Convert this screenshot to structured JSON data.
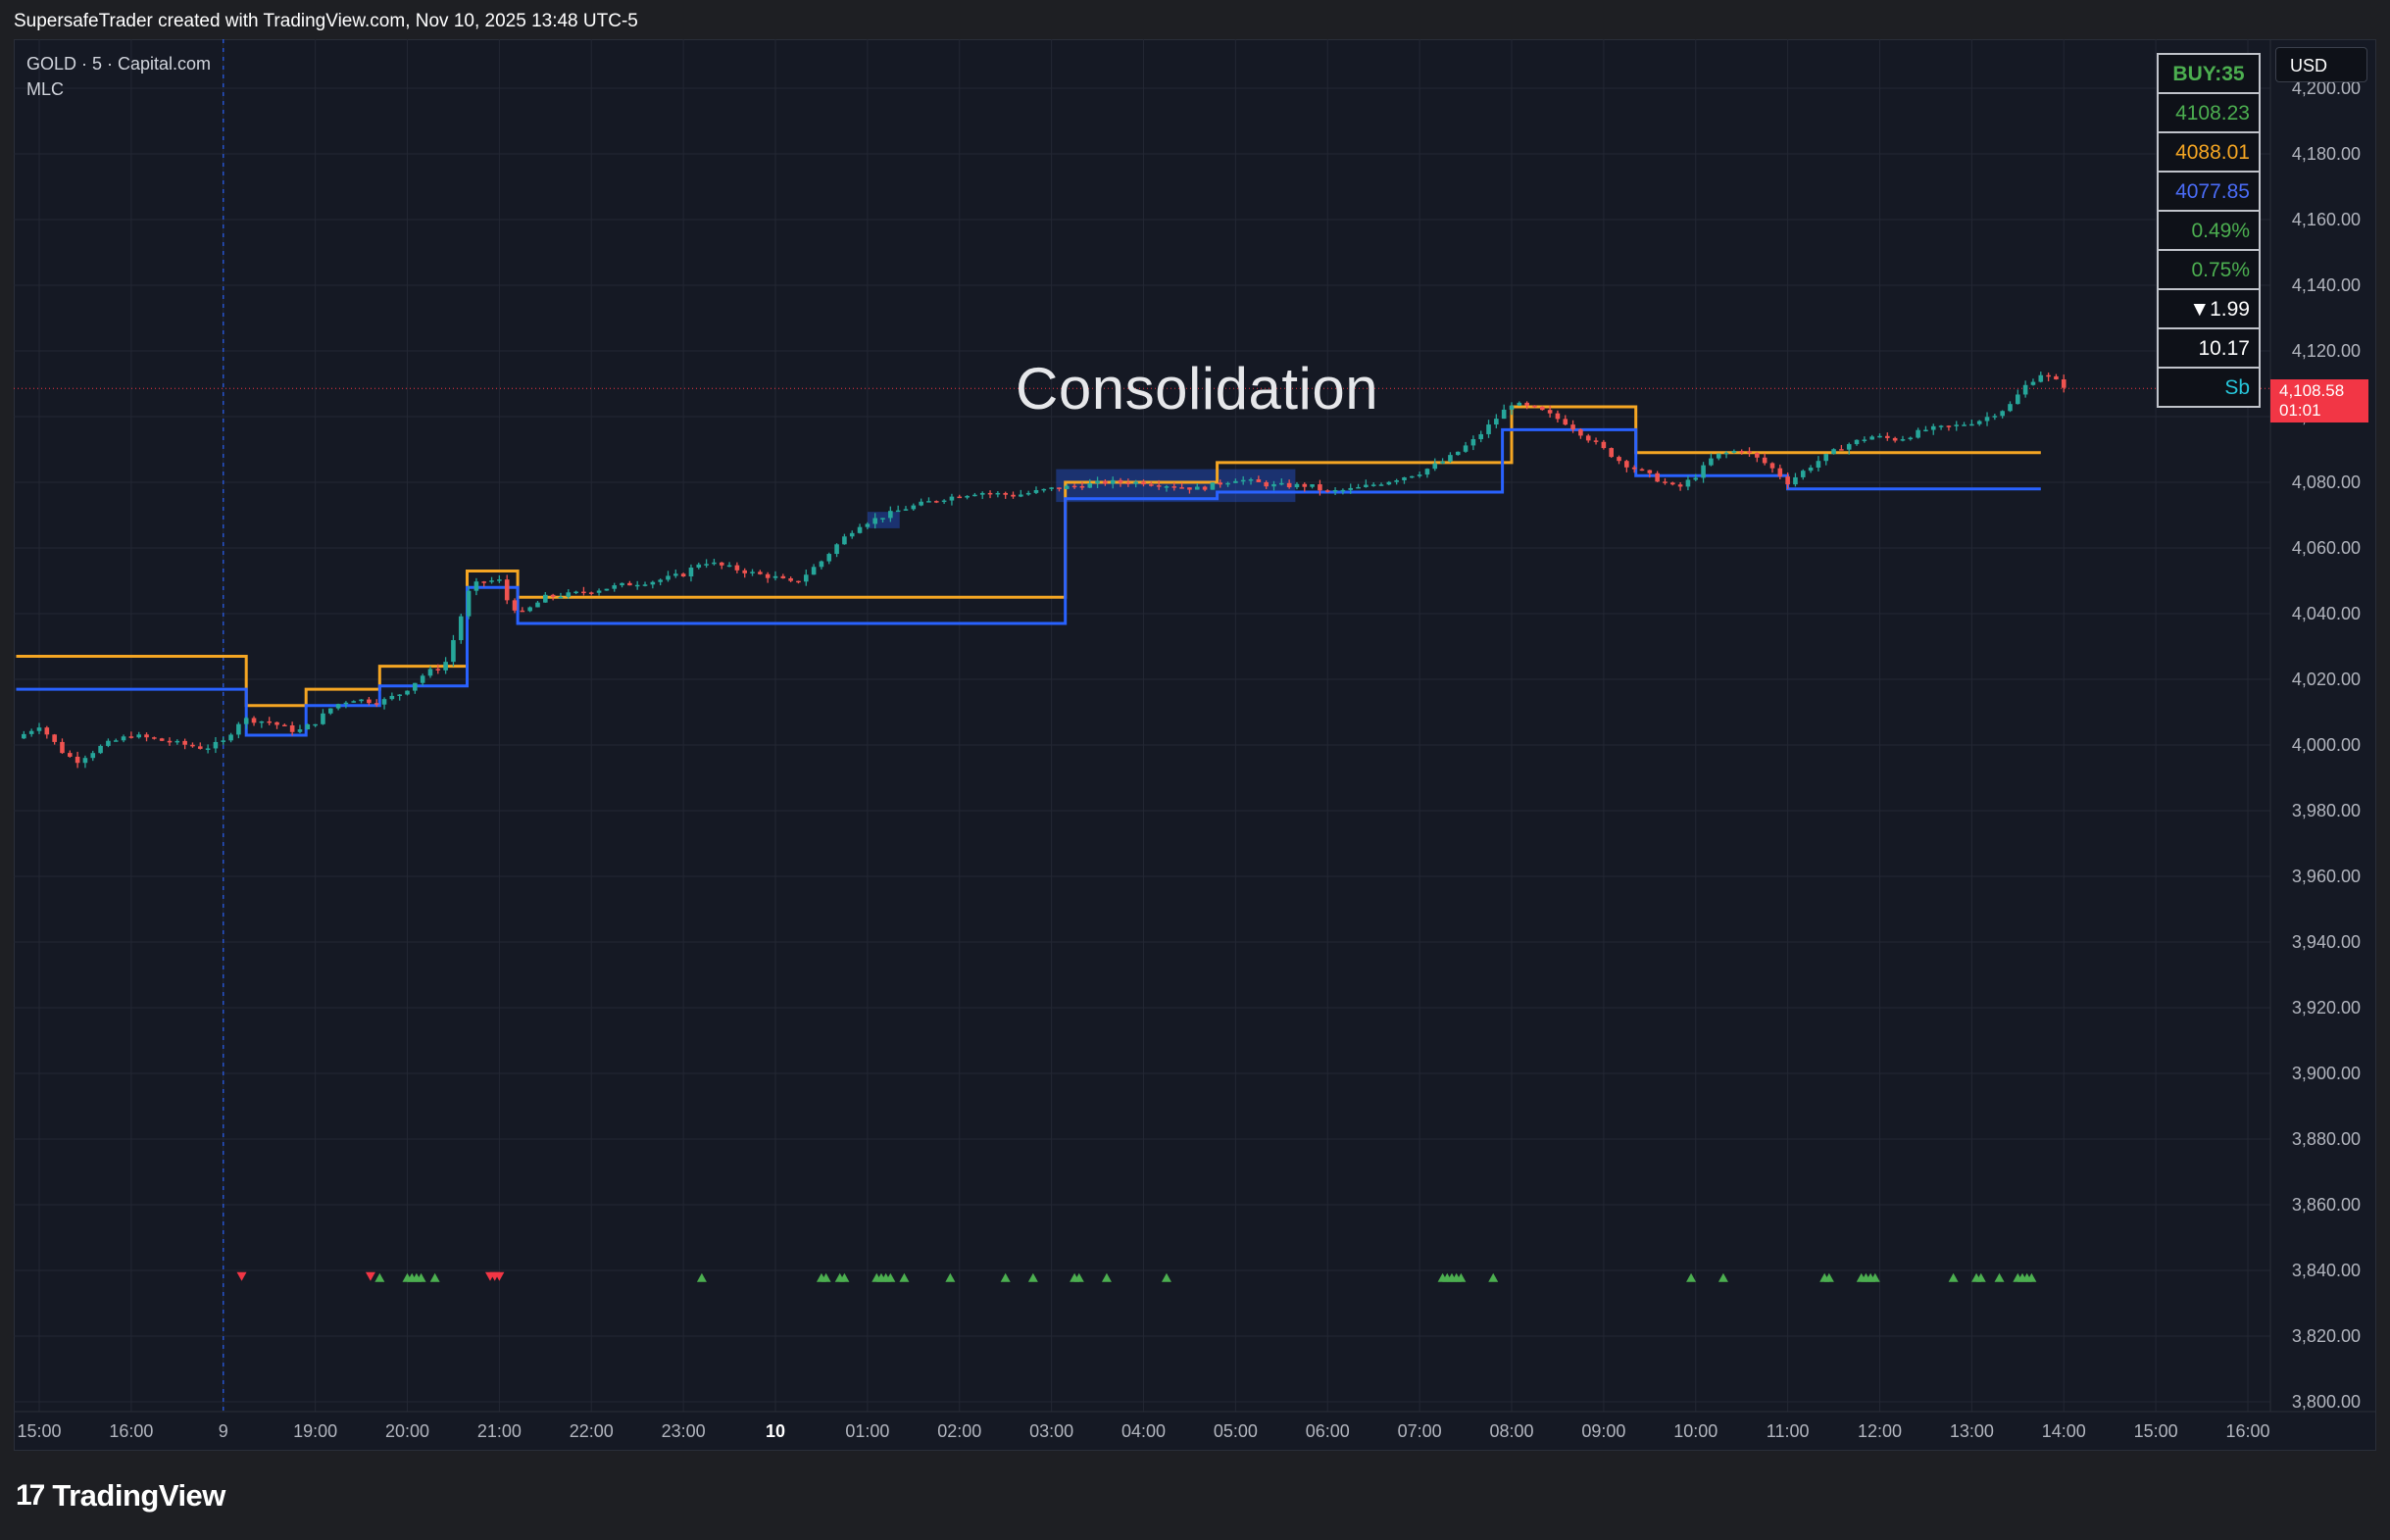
{
  "header": {
    "attribution": "SupersafeTrader created with TradingView.com, Nov 10, 2025 13:48 UTC-5"
  },
  "symbol": {
    "line1": "GOLD · 5 · Capital.com",
    "line2": "MLC"
  },
  "currency_button": "USD",
  "annotation": "Consolidation",
  "last_price": {
    "value": "4,108.58",
    "countdown": "01:01",
    "color": "#f23645"
  },
  "info_table": [
    {
      "text": "BUY:35",
      "color": "#4caf50",
      "bold": true
    },
    {
      "text": "4108.23",
      "color": "#4caf50"
    },
    {
      "text": "4088.01",
      "color": "#f5a623"
    },
    {
      "text": "4077.85",
      "color": "#4a6cf7"
    },
    {
      "text": "0.49%",
      "color": "#4caf50"
    },
    {
      "text": "0.75%",
      "color": "#4caf50"
    },
    {
      "text": "▼1.99",
      "color": "#ffffff"
    },
    {
      "text": "10.17",
      "color": "#ffffff"
    },
    {
      "text": "Sb",
      "color": "#26c6da"
    }
  ],
  "footer": {
    "brand": "TradingView",
    "mark": "17"
  },
  "colors": {
    "bull": "#26a69a",
    "bear": "#ef5350",
    "upper_line": "#f5a623",
    "lower_line": "#2962ff",
    "buy_marker": "#4caf50",
    "sell_marker": "#f23645",
    "zone": "#2962ff"
  },
  "chart_data": {
    "type": "candlestick",
    "title": "",
    "ylim": [
      3795,
      4205
    ],
    "y_ticks": [
      "4,200.00",
      "4,180.00",
      "4,160.00",
      "4,140.00",
      "4,120.00",
      "4,100.00",
      "4,080.00",
      "4,060.00",
      "4,040.00",
      "4,020.00",
      "4,000.00",
      "3,980.00",
      "3,960.00",
      "3,940.00",
      "3,920.00",
      "3,900.00",
      "3,880.00",
      "3,860.00",
      "3,840.00",
      "3,820.00",
      "3,800.00"
    ],
    "y_tick_values": [
      4200,
      4180,
      4160,
      4140,
      4120,
      4100,
      4080,
      4060,
      4040,
      4020,
      4000,
      3980,
      3960,
      3940,
      3920,
      3900,
      3880,
      3860,
      3840,
      3820,
      3800
    ],
    "x_ticks": [
      {
        "label": "15:00",
        "t": 15.0,
        "bold": false
      },
      {
        "label": "16:00",
        "t": 16.0,
        "bold": false
      },
      {
        "label": "9",
        "t": 17.0,
        "bold": false
      },
      {
        "label": "19:00",
        "t": 18.0,
        "bold": false
      },
      {
        "label": "20:00",
        "t": 19.0,
        "bold": false
      },
      {
        "label": "21:00",
        "t": 20.0,
        "bold": false
      },
      {
        "label": "22:00",
        "t": 21.0,
        "bold": false
      },
      {
        "label": "23:00",
        "t": 22.0,
        "bold": false
      },
      {
        "label": "10",
        "t": 23.0,
        "bold": true
      },
      {
        "label": "01:00",
        "t": 24.0,
        "bold": false
      },
      {
        "label": "02:00",
        "t": 25.0,
        "bold": false
      },
      {
        "label": "03:00",
        "t": 26.0,
        "bold": false
      },
      {
        "label": "04:00",
        "t": 27.0,
        "bold": false
      },
      {
        "label": "05:00",
        "t": 28.0,
        "bold": false
      },
      {
        "label": "06:00",
        "t": 29.0,
        "bold": false
      },
      {
        "label": "07:00",
        "t": 30.0,
        "bold": false
      },
      {
        "label": "08:00",
        "t": 31.0,
        "bold": false
      },
      {
        "label": "09:00",
        "t": 32.0,
        "bold": false
      },
      {
        "label": "10:00",
        "t": 33.0,
        "bold": false
      },
      {
        "label": "11:00",
        "t": 34.0,
        "bold": false
      },
      {
        "label": "12:00",
        "t": 35.0,
        "bold": false
      },
      {
        "label": "13:00",
        "t": 36.0,
        "bold": false
      },
      {
        "label": "14:00",
        "t": 37.0,
        "bold": false
      },
      {
        "label": "15:00",
        "t": 38.0,
        "bold": false
      },
      {
        "label": "16:00",
        "t": 39.0,
        "bold": false
      }
    ],
    "x_range": [
      14.75,
      39.25
    ],
    "session_line_t": 17.0,
    "last_price": 4108.58,
    "price_path": [
      [
        14.75,
        4002
      ],
      [
        15.0,
        4006
      ],
      [
        15.25,
        3998
      ],
      [
        15.4,
        3995
      ],
      [
        15.7,
        4000
      ],
      [
        16.0,
        4003
      ],
      [
        16.4,
        4001
      ],
      [
        16.8,
        3999
      ],
      [
        17.0,
        4001
      ],
      [
        17.2,
        4008
      ],
      [
        17.5,
        4007
      ],
      [
        17.8,
        4004
      ],
      [
        18.0,
        4007
      ],
      [
        18.2,
        4012
      ],
      [
        18.4,
        4014
      ],
      [
        18.7,
        4013
      ],
      [
        18.95,
        4016
      ],
      [
        19.2,
        4022
      ],
      [
        19.4,
        4024
      ],
      [
        19.55,
        4036
      ],
      [
        19.65,
        4046
      ],
      [
        19.75,
        4049
      ],
      [
        19.85,
        4050
      ],
      [
        20.0,
        4050
      ],
      [
        20.1,
        4043
      ],
      [
        20.25,
        4040
      ],
      [
        20.5,
        4045
      ],
      [
        20.8,
        4046
      ],
      [
        21.0,
        4047
      ],
      [
        21.4,
        4049
      ],
      [
        21.7,
        4050
      ],
      [
        22.0,
        4052
      ],
      [
        22.2,
        4056
      ],
      [
        22.5,
        4054
      ],
      [
        22.8,
        4052
      ],
      [
        23.0,
        4051
      ],
      [
        23.2,
        4049
      ],
      [
        23.5,
        4056
      ],
      [
        23.7,
        4062
      ],
      [
        23.9,
        4067
      ],
      [
        24.1,
        4069
      ],
      [
        24.4,
        4072
      ],
      [
        24.8,
        4075
      ],
      [
        25.2,
        4077
      ],
      [
        25.6,
        4076
      ],
      [
        26.0,
        4078
      ],
      [
        26.3,
        4079
      ],
      [
        26.6,
        4080
      ],
      [
        27.0,
        4080
      ],
      [
        27.3,
        4079
      ],
      [
        27.6,
        4078
      ],
      [
        28.0,
        4081
      ],
      [
        28.4,
        4079
      ],
      [
        28.8,
        4079
      ],
      [
        29.0,
        4077
      ],
      [
        29.3,
        4078
      ],
      [
        29.6,
        4080
      ],
      [
        30.0,
        4083
      ],
      [
        30.3,
        4087
      ],
      [
        30.6,
        4093
      ],
      [
        30.85,
        4100
      ],
      [
        31.0,
        4104
      ],
      [
        31.3,
        4102
      ],
      [
        31.6,
        4098
      ],
      [
        31.9,
        4092
      ],
      [
        32.2,
        4086
      ],
      [
        32.5,
        4082
      ],
      [
        32.8,
        4078
      ],
      [
        33.0,
        4082
      ],
      [
        33.2,
        4088
      ],
      [
        33.5,
        4090
      ],
      [
        33.8,
        4085
      ],
      [
        34.0,
        4080
      ],
      [
        34.3,
        4086
      ],
      [
        34.6,
        4091
      ],
      [
        34.9,
        4094
      ],
      [
        35.2,
        4093
      ],
      [
        35.5,
        4096
      ],
      [
        35.8,
        4097
      ],
      [
        36.1,
        4099
      ],
      [
        36.4,
        4103
      ],
      [
        36.6,
        4110
      ],
      [
        36.75,
        4113
      ],
      [
        36.9,
        4111
      ],
      [
        37.05,
        4108.58
      ]
    ],
    "series": [
      {
        "name": "",
        "color": "#f5a623",
        "step": [
          [
            14.75,
            4027
          ],
          [
            17.25,
            4027
          ],
          [
            17.25,
            4012
          ],
          [
            17.9,
            4012
          ],
          [
            17.9,
            4017
          ],
          [
            18.7,
            4017
          ],
          [
            18.7,
            4024
          ],
          [
            19.65,
            4024
          ],
          [
            19.65,
            4053
          ],
          [
            20.2,
            4053
          ],
          [
            20.2,
            4045
          ],
          [
            26.15,
            4045
          ],
          [
            26.15,
            4080
          ],
          [
            27.8,
            4080
          ],
          [
            27.8,
            4086
          ],
          [
            31.0,
            4086
          ],
          [
            31.0,
            4103
          ],
          [
            32.35,
            4103
          ],
          [
            32.35,
            4089
          ],
          [
            36.75,
            4089
          ]
        ]
      },
      {
        "name": "",
        "color": "#2962ff",
        "step": [
          [
            14.75,
            4017
          ],
          [
            17.25,
            4017
          ],
          [
            17.25,
            4003
          ],
          [
            17.9,
            4003
          ],
          [
            17.9,
            4012
          ],
          [
            18.7,
            4012
          ],
          [
            18.7,
            4018
          ],
          [
            19.65,
            4018
          ],
          [
            19.65,
            4048
          ],
          [
            20.2,
            4048
          ],
          [
            20.2,
            4037
          ],
          [
            26.15,
            4037
          ],
          [
            26.15,
            4075
          ],
          [
            27.8,
            4075
          ],
          [
            27.8,
            4077
          ],
          [
            30.9,
            4077
          ],
          [
            30.9,
            4096
          ],
          [
            32.35,
            4096
          ],
          [
            32.35,
            4082
          ],
          [
            34.0,
            4082
          ],
          [
            34.0,
            4078
          ],
          [
            36.75,
            4078
          ]
        ]
      }
    ],
    "zones": [
      {
        "t0": 24.0,
        "t1": 24.35,
        "y0": 4066,
        "y1": 4071
      },
      {
        "t0": 26.05,
        "t1": 28.65,
        "y0": 4074,
        "y1": 4084
      }
    ],
    "markers": {
      "y": 3838,
      "sell_t": [
        17.2,
        18.6,
        19.9,
        19.95,
        20.0
      ],
      "buy_t": [
        18.7,
        19.0,
        19.05,
        19.1,
        19.15,
        19.3,
        22.2,
        23.5,
        23.55,
        23.7,
        23.75,
        24.1,
        24.15,
        24.2,
        24.25,
        24.4,
        24.9,
        25.5,
        25.8,
        26.25,
        26.3,
        26.6,
        27.25,
        30.25,
        30.3,
        30.35,
        30.4,
        30.45,
        30.8,
        32.95,
        33.3,
        34.4,
        34.45,
        34.8,
        34.85,
        34.9,
        34.95,
        35.8,
        36.05,
        36.1,
        36.3,
        36.5,
        36.55,
        36.6,
        36.65
      ]
    }
  }
}
